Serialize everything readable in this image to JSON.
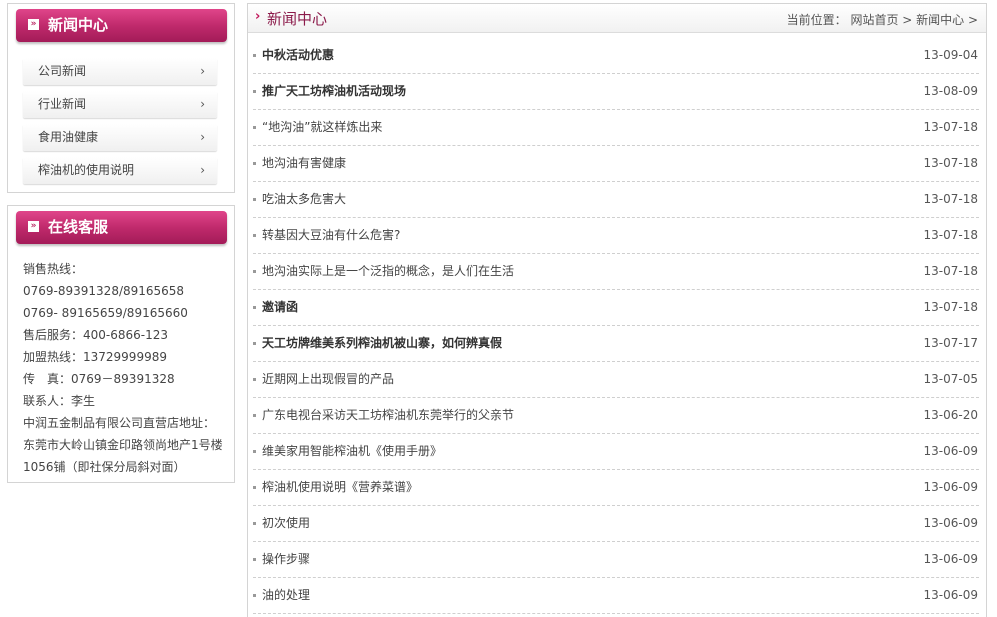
{
  "sidebar": {
    "news_panel": {
      "title": "新闻中心",
      "items": [
        {
          "label": "公司新闻"
        },
        {
          "label": "行业新闻"
        },
        {
          "label": "食用油健康"
        },
        {
          "label": "榨油机的使用说明"
        }
      ],
      "chevron": "›"
    },
    "service_panel": {
      "title": "在线客服",
      "lines": [
        "销售热线：",
        "0769-89391328/89165658",
        "0769- 89165659/89165660",
        "售后服务：400-6866-123",
        "加盟热线：13729999989",
        "传　真：0769－89391328",
        "联系人：李生",
        "中润五金制品有限公司直营店地址：",
        "东莞市大岭山镇金印路领尚地产1号楼",
        "1056铺（即社保分局斜对面）"
      ]
    },
    "icon_glyph": "»"
  },
  "main": {
    "title": "新闻中心",
    "breadcrumb": "当前位置：  网站首页 > 新闻中心 >",
    "arrow_glyph": "›",
    "news": [
      {
        "title": "中秋活动优惠",
        "date": "13-09-04",
        "bold": true
      },
      {
        "title": "推广天工坊榨油机活动现场",
        "date": "13-08-09",
        "bold": true
      },
      {
        "title": "“地沟油”就这样炼出来",
        "date": "13-07-18",
        "bold": false
      },
      {
        "title": "地沟油有害健康",
        "date": "13-07-18",
        "bold": false
      },
      {
        "title": "吃油太多危害大",
        "date": "13-07-18",
        "bold": false
      },
      {
        "title": "转基因大豆油有什么危害?",
        "date": "13-07-18",
        "bold": false
      },
      {
        "title": "地沟油实际上是一个泛指的概念，是人们在生活",
        "date": "13-07-18",
        "bold": false
      },
      {
        "title": "邀请函",
        "date": "13-07-18",
        "bold": true
      },
      {
        "title": "天工坊牌维美系列榨油机被山寨，如何辨真假",
        "date": "13-07-17",
        "bold": true
      },
      {
        "title": "近期网上出现假冒的产品",
        "date": "13-07-05",
        "bold": false
      },
      {
        "title": "广东电视台采访天工坊榨油机东莞举行的父亲节",
        "date": "13-06-20",
        "bold": false
      },
      {
        "title": "维美家用智能榨油机《使用手册》",
        "date": "13-06-09",
        "bold": false
      },
      {
        "title": "榨油机使用说明《营养菜谱》",
        "date": "13-06-09",
        "bold": false
      },
      {
        "title": "初次使用",
        "date": "13-06-09",
        "bold": false
      },
      {
        "title": "操作步骤",
        "date": "13-06-09",
        "bold": false
      },
      {
        "title": "油的处理",
        "date": "13-06-09",
        "bold": false
      }
    ]
  },
  "colors": {
    "accent": "#c02a6c",
    "title_text": "#8b1a4a"
  }
}
